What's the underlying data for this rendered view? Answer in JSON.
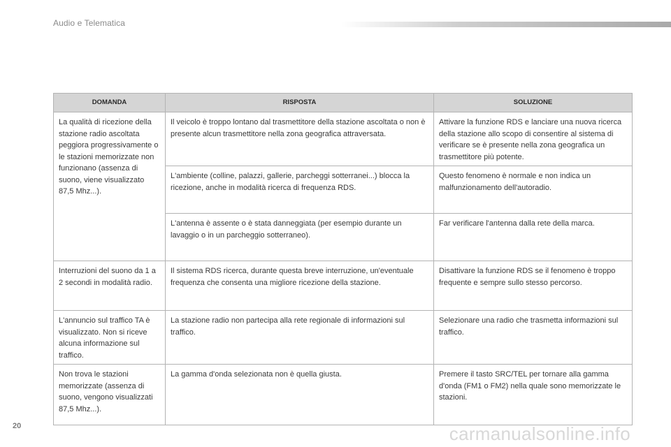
{
  "header": {
    "title": "Audio e Telematica"
  },
  "table": {
    "columns": [
      "DOMANDA",
      "RISPOSTA",
      "SOLUZIONE"
    ],
    "groups": [
      {
        "question": "La qualità di ricezione della stazione radio ascoltata peggiora progressivamente o le stazioni memorizzate non funzionano (assenza di suono, viene visualizzato 87,5 Mhz...).",
        "rows": [
          {
            "answer": "Il veicolo è troppo lontano dal trasmettitore della stazione ascoltata o non è presente alcun trasmettitore nella zona geografica attraversata.",
            "solution": "Attivare la funzione RDS e lanciare una nuova ricerca della stazione allo scopo di consentire al sistema di verificare se è presente nella zona geografica un trasmettitore più potente."
          },
          {
            "answer": "L'ambiente (colline, palazzi, gallerie, parcheggi sotterranei...) blocca la ricezione, anche in modalità ricerca di frequenza RDS.",
            "solution": "Questo fenomeno è normale e non indica un malfunzionamento dell'autoradio."
          },
          {
            "answer": "L'antenna è assente o è stata danneggiata (per esempio durante un lavaggio o in un parcheggio sotterraneo).",
            "solution": "Far verificare l'antenna dalla rete della marca."
          }
        ]
      },
      {
        "question": "Interruzioni del suono da 1 a 2 secondi in modalità radio.",
        "rows": [
          {
            "answer": "Il sistema RDS ricerca, durante questa breve interruzione, un'eventuale frequenza che consenta una migliore ricezione della stazione.",
            "solution": "Disattivare la funzione RDS se il fenomeno è troppo frequente e sempre sullo stesso percorso."
          }
        ]
      },
      {
        "question": "L'annuncio sul traffico TA è visualizzato. Non si riceve alcuna informazione sul traffico.",
        "rows": [
          {
            "answer": "La stazione radio non partecipa alla rete regionale di informazioni sul traffico.",
            "solution": "Selezionare una radio che trasmetta informazioni sul traffico."
          }
        ]
      },
      {
        "question": "Non trova le stazioni memorizzate (assenza di suono, vengono visualizzati 87,5 Mhz...).",
        "rows": [
          {
            "answer": "La gamma d'onda selezionata non è quella giusta.",
            "solution": "Premere il tasto SRC/TEL per tornare alla gamma d'onda (FM1 o FM2) nella quale sono memorizzate le stazioni."
          }
        ]
      }
    ]
  },
  "footer": {
    "page_number": "20",
    "watermark": "carmanualsonline.info"
  }
}
